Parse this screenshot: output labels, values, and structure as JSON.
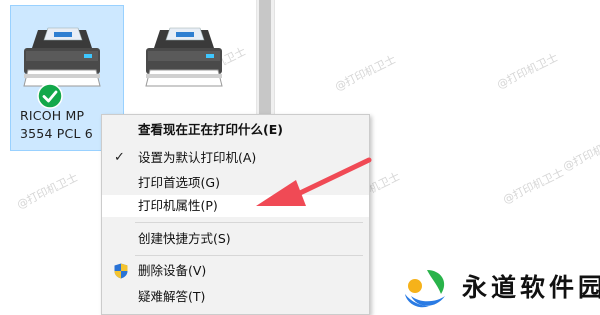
{
  "devices": [
    {
      "name": "RICOH MP\n3554 PCL 6",
      "selected": true,
      "default_badge": "check-icon"
    },
    {
      "name": "",
      "selected": false
    }
  ],
  "context_menu": {
    "items": [
      {
        "label": "查看现在正在打印什么(E)",
        "bold": true,
        "checked": false,
        "shield": false
      },
      {
        "label": "设置为默认打印机(A)",
        "bold": false,
        "checked": true,
        "shield": false
      },
      {
        "label": "打印首选项(G)",
        "bold": false,
        "checked": false,
        "shield": false
      },
      {
        "label": "打印机属性(P)",
        "bold": false,
        "checked": false,
        "shield": false,
        "highlighted": true
      },
      {
        "label": "创建快捷方式(S)",
        "bold": false,
        "checked": false,
        "shield": false
      },
      {
        "label": "删除设备(V)",
        "bold": false,
        "checked": false,
        "shield": true
      },
      {
        "label": "疑难解答(T)",
        "bold": false,
        "checked": false,
        "shield": false
      }
    ]
  },
  "watermark_text": "@打印机卫士",
  "brand": {
    "name": "永道软件园"
  },
  "colors": {
    "selection_bg": "#cde8ff",
    "selection_border": "#99d1ff",
    "menu_bg": "#f2f2f2",
    "arrow": "#f04a55",
    "check_green": "#13a84a"
  }
}
